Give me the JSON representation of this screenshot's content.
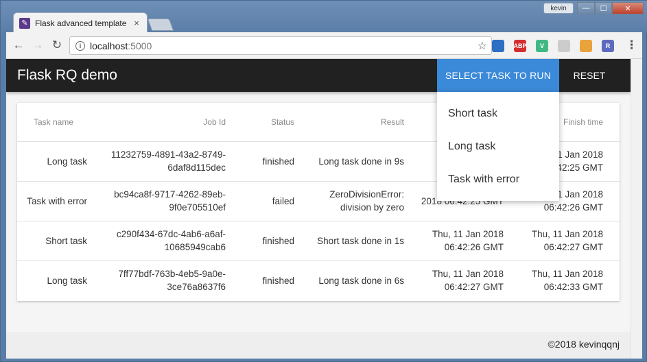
{
  "browser": {
    "tab_title": "Flask advanced template",
    "tab_close": "×",
    "user_badge": "kevin",
    "url_host": "localhost",
    "url_port": ":5000",
    "controls": {
      "minimize": "—",
      "maximize": "☐",
      "close": "✕"
    }
  },
  "app": {
    "title": "Flask RQ demo",
    "select_button": "SELECT TASK TO RUN",
    "reset_button": "RESET"
  },
  "dropdown": {
    "items": [
      "Short task",
      "Long task",
      "Task with error"
    ]
  },
  "table": {
    "headers": [
      "Task name",
      "Job Id",
      "Status",
      "Result",
      "",
      "Finish time"
    ],
    "rows": [
      [
        "Long task",
        "11232759-4891-43a2-8749-6daf8d115dec",
        "finished",
        "Long task done in 9s",
        "",
        "Thu, 11 Jan 2018 06:42:25 GMT"
      ],
      [
        "Task with error",
        "bc94ca8f-9717-4262-89eb-9f0e705510ef",
        "failed",
        "ZeroDivisionError: division by zero",
        "2018 06:42:25 GMT",
        "Thu, 11 Jan 2018 06:42:26 GMT"
      ],
      [
        "Short task",
        "c290f434-67dc-4ab6-a6af-10685949cab6",
        "finished",
        "Short task done in 1s",
        "Thu, 11 Jan 2018 06:42:26 GMT",
        "Thu, 11 Jan 2018 06:42:27 GMT"
      ],
      [
        "Long task",
        "7ff77bdf-763b-4eb5-9a0e-3ce76a8637f6",
        "finished",
        "Long task done in 6s",
        "Thu, 11 Jan 2018 06:42:27 GMT",
        "Thu, 11 Jan 2018 06:42:33 GMT"
      ]
    ]
  },
  "footer": {
    "text": "©2018 kevinqqnj"
  },
  "extensions": [
    {
      "name": "globe-extension-icon",
      "color": "#2e6fc4",
      "label": ""
    },
    {
      "name": "adblock-extension-icon",
      "color": "#d32f2f",
      "label": "ABP"
    },
    {
      "name": "vue-devtools-icon",
      "color": "#41b883",
      "label": "V"
    },
    {
      "name": "ghost-extension-icon",
      "color": "#cccccc",
      "label": ""
    },
    {
      "name": "chrome-extension-icon",
      "color": "#e8a33d",
      "label": ""
    },
    {
      "name": "redux-extension-icon",
      "color": "#5c6bc0",
      "label": "R"
    }
  ]
}
